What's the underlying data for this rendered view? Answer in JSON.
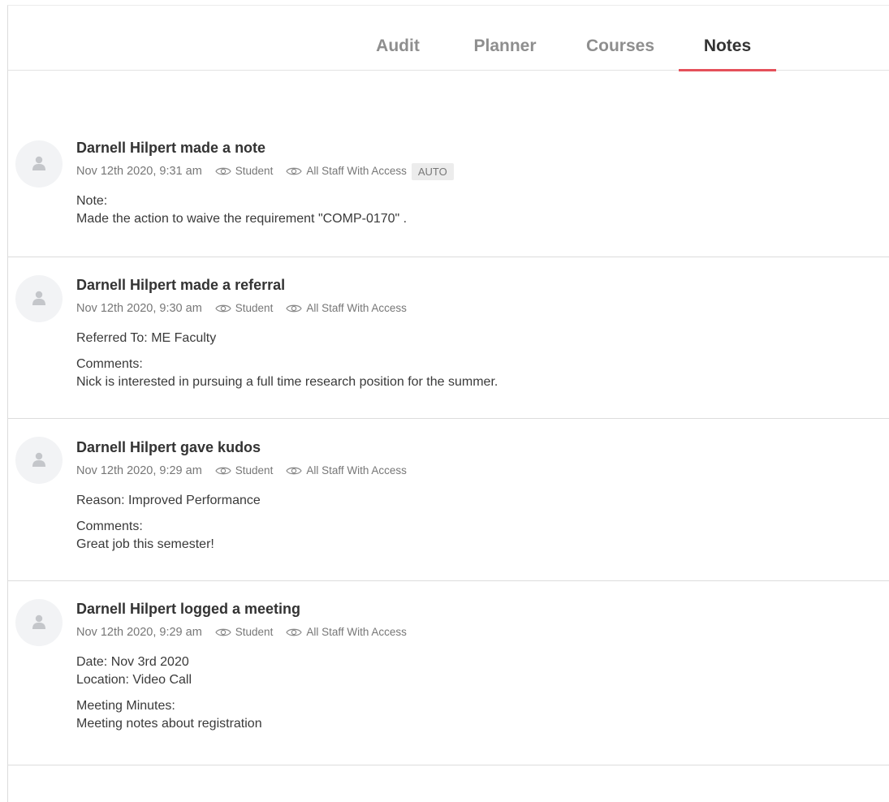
{
  "tabs": [
    {
      "label": "Audit"
    },
    {
      "label": "Planner"
    },
    {
      "label": "Courses"
    },
    {
      "label": "Notes"
    }
  ],
  "active_tab": "Notes",
  "accent_color": "#e5505a",
  "entries": [
    {
      "title": "Darnell Hilpert made a note",
      "timestamp": "Nov 12th 2020, 9:31 am",
      "visibility": [
        "Student",
        "All Staff With Access"
      ],
      "badge": "AUTO",
      "body": [
        "Note:",
        "Made the action to waive the requirement \"COMP-0170\" ."
      ]
    },
    {
      "title": "Darnell Hilpert made a referral",
      "timestamp": "Nov 12th 2020, 9:30 am",
      "visibility": [
        "Student",
        "All Staff With Access"
      ],
      "body": [
        "Referred To: ME Faculty",
        "Comments:",
        "Nick is interested in pursuing a full time research position for the summer."
      ]
    },
    {
      "title": "Darnell Hilpert gave kudos",
      "timestamp": "Nov 12th 2020, 9:29 am",
      "visibility": [
        "Student",
        "All Staff With Access"
      ],
      "body": [
        "Reason: Improved Performance",
        "Comments:",
        "Great job this semester!"
      ]
    },
    {
      "title": "Darnell Hilpert logged a meeting",
      "timestamp": "Nov 12th 2020, 9:29 am",
      "visibility": [
        "Student",
        "All Staff With Access"
      ],
      "body": [
        "Date: Nov 3rd 2020",
        "Location: Video Call",
        "Meeting Minutes:",
        "Meeting notes about registration"
      ]
    }
  ]
}
